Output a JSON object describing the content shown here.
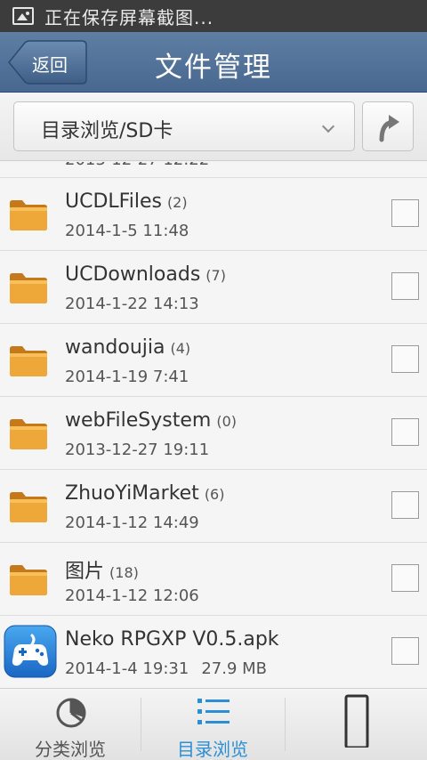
{
  "status_bar": {
    "text": "正在保存屏幕截图...",
    "icon": "image-icon"
  },
  "header": {
    "back_label": "返回",
    "title": "文件管理"
  },
  "path_bar": {
    "path": "目录浏览/SD卡",
    "dropdown_icon": "chevron-down-icon",
    "up_icon": "folder-up-icon"
  },
  "list": {
    "partial_date": "2013-12-27 12:22",
    "items": [
      {
        "name": "UCDLFiles",
        "count": "(2)",
        "date": "2014-1-5 11:48",
        "type": "folder"
      },
      {
        "name": "UCDownloads",
        "count": "(7)",
        "date": "2014-1-22 14:13",
        "type": "folder"
      },
      {
        "name": "wandoujia",
        "count": "(4)",
        "date": "2014-1-19 7:41",
        "type": "folder"
      },
      {
        "name": "webFileSystem",
        "count": "(0)",
        "date": "2013-12-27 19:11",
        "type": "folder"
      },
      {
        "name": "ZhuoYiMarket",
        "count": "(6)",
        "date": "2014-1-12 14:49",
        "type": "folder"
      },
      {
        "name": "图片",
        "count": "(18)",
        "date": "2014-1-12 12:06",
        "type": "folder"
      },
      {
        "name": "Neko RPGXP V0.5.apk",
        "count": "",
        "date": "2014-1-4 19:31",
        "size": "27.9 MB",
        "type": "apk"
      }
    ]
  },
  "tabs": [
    {
      "label": "分类浏览",
      "icon": "pie-chart-icon",
      "active": false
    },
    {
      "label": "目录浏览",
      "icon": "list-icon",
      "active": true
    },
    {
      "label": "",
      "icon": "phone-icon",
      "active": false
    }
  ],
  "colors": {
    "header": "#53739a",
    "active_tab": "#2b8fd6",
    "inactive_tab": "#555555",
    "folder": "#e9a02c"
  }
}
